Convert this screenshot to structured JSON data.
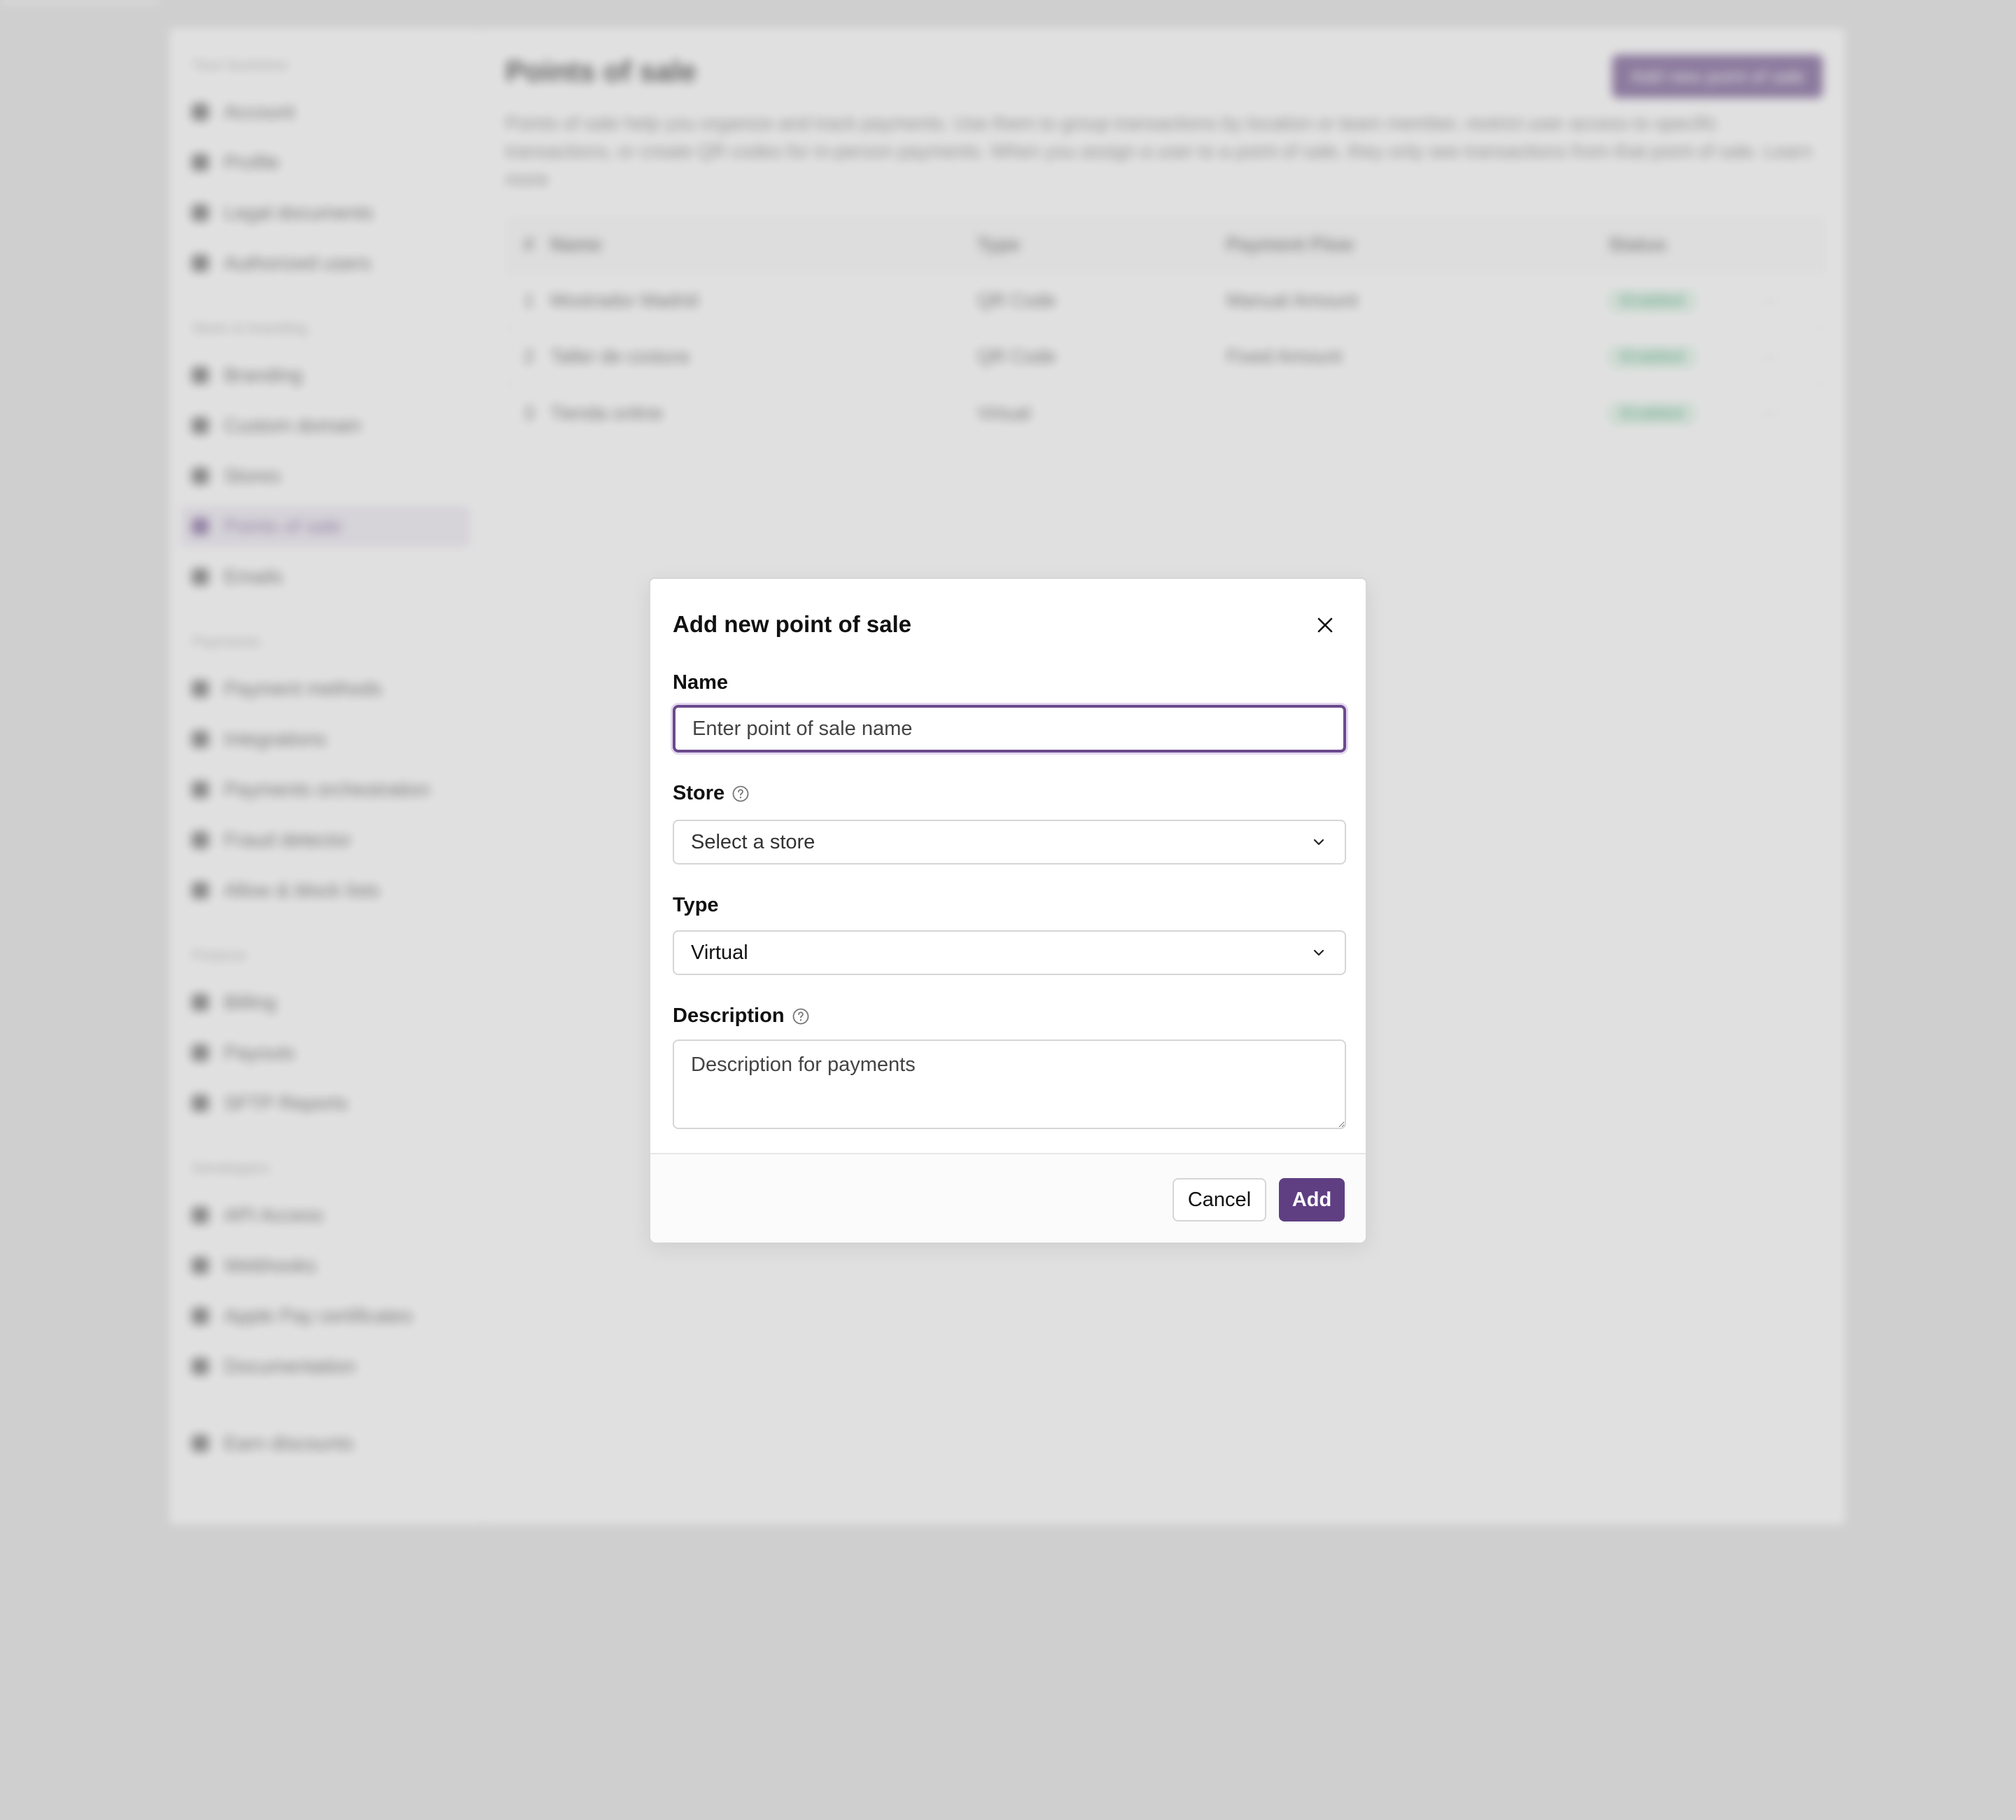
{
  "background": {
    "sidebar": {
      "groups": [
        {
          "title": "Your business",
          "items": [
            {
              "label": "Account",
              "icon": "building-icon"
            },
            {
              "label": "Profile",
              "icon": "user-icon"
            },
            {
              "label": "Legal documents",
              "icon": "document-icon"
            },
            {
              "label": "Authorized users",
              "icon": "users-icon"
            }
          ]
        },
        {
          "title": "Store & branding",
          "items": [
            {
              "label": "Branding",
              "icon": "brush-icon"
            },
            {
              "label": "Custom domain",
              "icon": "globe-icon"
            },
            {
              "label": "Stores",
              "icon": "store-icon"
            },
            {
              "label": "Points of sale",
              "icon": "qr-icon",
              "active": true
            },
            {
              "label": "Emails",
              "icon": "mail-icon"
            }
          ]
        },
        {
          "title": "Payments",
          "items": [
            {
              "label": "Payment methods",
              "icon": "card-icon"
            },
            {
              "label": "Integrations",
              "icon": "grid-icon"
            },
            {
              "label": "Payments orchestration",
              "icon": "flow-icon"
            },
            {
              "label": "Fraud detector",
              "icon": "shield-icon"
            },
            {
              "label": "Allow & block lists",
              "icon": "ban-icon"
            }
          ]
        },
        {
          "title": "Finance",
          "items": [
            {
              "label": "Billing",
              "icon": "receipt-icon"
            },
            {
              "label": "Payouts",
              "icon": "bank-icon"
            },
            {
              "label": "SFTP Reports",
              "icon": "refresh-icon"
            }
          ]
        },
        {
          "title": "Developers",
          "items": [
            {
              "label": "API Access",
              "icon": "key-icon"
            },
            {
              "label": "Webhooks",
              "icon": "webhook-icon"
            },
            {
              "label": "Apple Pay certificates",
              "icon": "apple-icon"
            },
            {
              "label": "Documentation",
              "icon": "code-icon"
            }
          ]
        }
      ],
      "footer_item": {
        "label": "Earn discounts",
        "icon": "gift-icon"
      }
    },
    "main": {
      "title": "Points of sale",
      "add_button_label": "Add new point of sale",
      "description": "Points of sale help you organize and track payments. Use them to group transactions by location or team member, restrict user access to specific transactions, or create QR codes for in-person payments. When you assign a user to a point of sale, they only see transactions from that point of sale. Learn more",
      "table": {
        "headers": [
          "#",
          "Name",
          "Type",
          "Payment Flow",
          "Status"
        ],
        "rows": [
          {
            "num": "1",
            "name": "Mostrador Madrid",
            "type": "QR Code",
            "flow": "Manual Amount",
            "status": "Enabled"
          },
          {
            "num": "2",
            "name": "Taller de costura",
            "type": "QR Code",
            "flow": "Fixed Amount",
            "status": "Enabled"
          },
          {
            "num": "3",
            "name": "Tienda online",
            "type": "Virtual",
            "flow": "",
            "status": "Enabled"
          }
        ]
      }
    }
  },
  "modal": {
    "title": "Add new point of sale",
    "name": {
      "label": "Name",
      "value": "",
      "placeholder": "Enter point of sale name"
    },
    "store": {
      "label": "Store",
      "selected": "Select a store"
    },
    "type": {
      "label": "Type",
      "selected": "Virtual"
    },
    "description": {
      "label": "Description",
      "value": "",
      "placeholder": "Description for payments"
    },
    "cancel_label": "Cancel",
    "add_label": "Add"
  },
  "colors": {
    "accent": "#5f3f82",
    "focus_ring": "#6b4a8c",
    "status_green": "#22955a"
  }
}
